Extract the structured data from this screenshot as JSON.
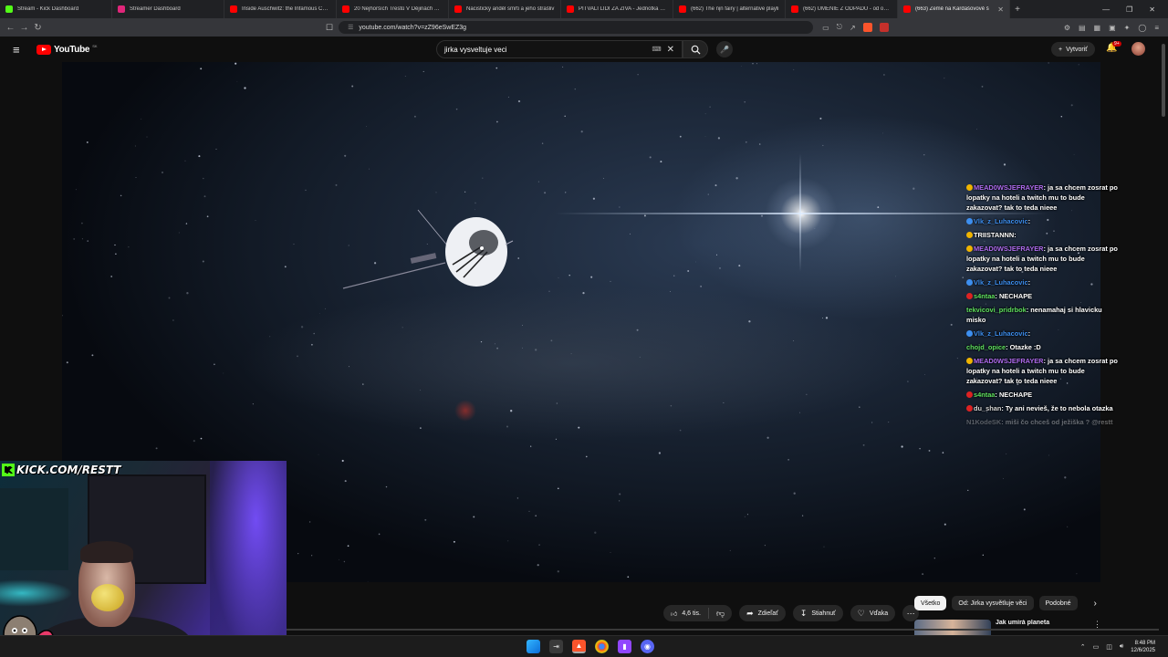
{
  "browser": {
    "tabs": [
      {
        "title": "Stream - Kick Dashboard",
        "color": "#53fc18",
        "active": false
      },
      {
        "title": "Streamer Dashboard",
        "color": "#e0267a",
        "active": false
      },
      {
        "title": "Inside Auschwitz: the Infamous Conc",
        "color": "#ff0000",
        "active": false
      },
      {
        "title": "20 Nejhorších Trestů V Dějinách Lidst",
        "color": "#ff0000",
        "active": false
      },
      {
        "title": "Nacistický anděl smrti a jeho strašliv",
        "color": "#ff0000",
        "active": false
      },
      {
        "title": "PITVALI LIDI ZA ŽIVA - Jednotka 731",
        "color": "#ff0000",
        "active": false
      },
      {
        "title": "(662) The ni̧n fairy | alternative playli",
        "color": "#ff0000",
        "active": false
      },
      {
        "title": "(662) UMENIE Z ODPADU - od opust",
        "color": "#ff0000",
        "active": false
      },
      {
        "title": "(663) Země na Kardašovově š",
        "color": "#ff0000",
        "active": true
      }
    ],
    "url": "youtube.com/watch?v=zZ96eSwEZ3g"
  },
  "youtube": {
    "logo_text": "YouTube",
    "country_code": "SK",
    "search_value": "jirka vysveltuje veci",
    "create_label": "Vytvoriť",
    "notif_count": "9+"
  },
  "chat": [
    {
      "user": "MEAD0WSJEFRAYER",
      "color": "u-purple",
      "text": "ja sa chcem zosrat po lopatky na hoteli a twitch mu to bude zakazovat? tak to teda nieee",
      "badge": "#f0b400"
    },
    {
      "user": "Vlk_z_Luhacovic",
      "color": "u-blue",
      "text": "",
      "badge": "#3d8ff0"
    },
    {
      "user": "TRIISTANNN",
      "color": "u-white",
      "text": "",
      "badge": "#f0b400"
    },
    {
      "user": "MEAD0WSJEFRAYER",
      "color": "u-purple",
      "text": "ja sa chcem zosrat po lopatky na hoteli a twitch mu to bude zakazovat? tak to teda nieee",
      "badge": "#f0b400"
    },
    {
      "user": "Vlk_z_Luhacovic",
      "color": "u-blue",
      "text": "",
      "badge": "#3d8ff0"
    },
    {
      "user": "s4ntaa",
      "color": "u-green",
      "text": "NECHAPE",
      "badge": "#d22"
    },
    {
      "user": "tekvicovi_pridrbok",
      "color": "u-green",
      "text": "nenamahaj si hlavicku misko",
      "badge": ""
    },
    {
      "user": "Vlk_z_Luhacovic",
      "color": "u-blue",
      "text": "",
      "badge": "#3d8ff0"
    },
    {
      "user": "chojd_opice",
      "color": "u-green",
      "text": "Otazke :D",
      "badge": ""
    },
    {
      "user": "MEAD0WSJEFRAYER",
      "color": "u-purple",
      "text": "ja sa chcem zosrat po lopatky na hoteli a twitch mu to bude zakazovat? tak to teda nieee",
      "badge": "#f0b400"
    },
    {
      "user": "s4ntaa",
      "color": "u-green",
      "text": "NECHAPE",
      "badge": "#d22"
    },
    {
      "user": "du_shan",
      "color": "u-gray",
      "text": "Ty ani nevieš, že to nebola otazka",
      "badge": "#d22"
    },
    {
      "user": "N1KodeSK",
      "color": "u-gray",
      "text": "miši čo chceš od ježiška ? @restt",
      "badge": "",
      "faded": true
    }
  ],
  "overlay": {
    "kick_text": "KICK.COM/RESTT"
  },
  "actions": {
    "likes": "4,6 tis.",
    "share": "Zdieľať",
    "download": "Stiahnuť",
    "thanks": "Vďaka"
  },
  "chips": [
    "Všetko",
    "Od: Jirka vysvětluje věci",
    "Podobné"
  ],
  "recommendation": {
    "title": "Jak umírá planeta"
  },
  "taskbar": {
    "time": "8:48 PM",
    "date": "12/6/2025"
  }
}
